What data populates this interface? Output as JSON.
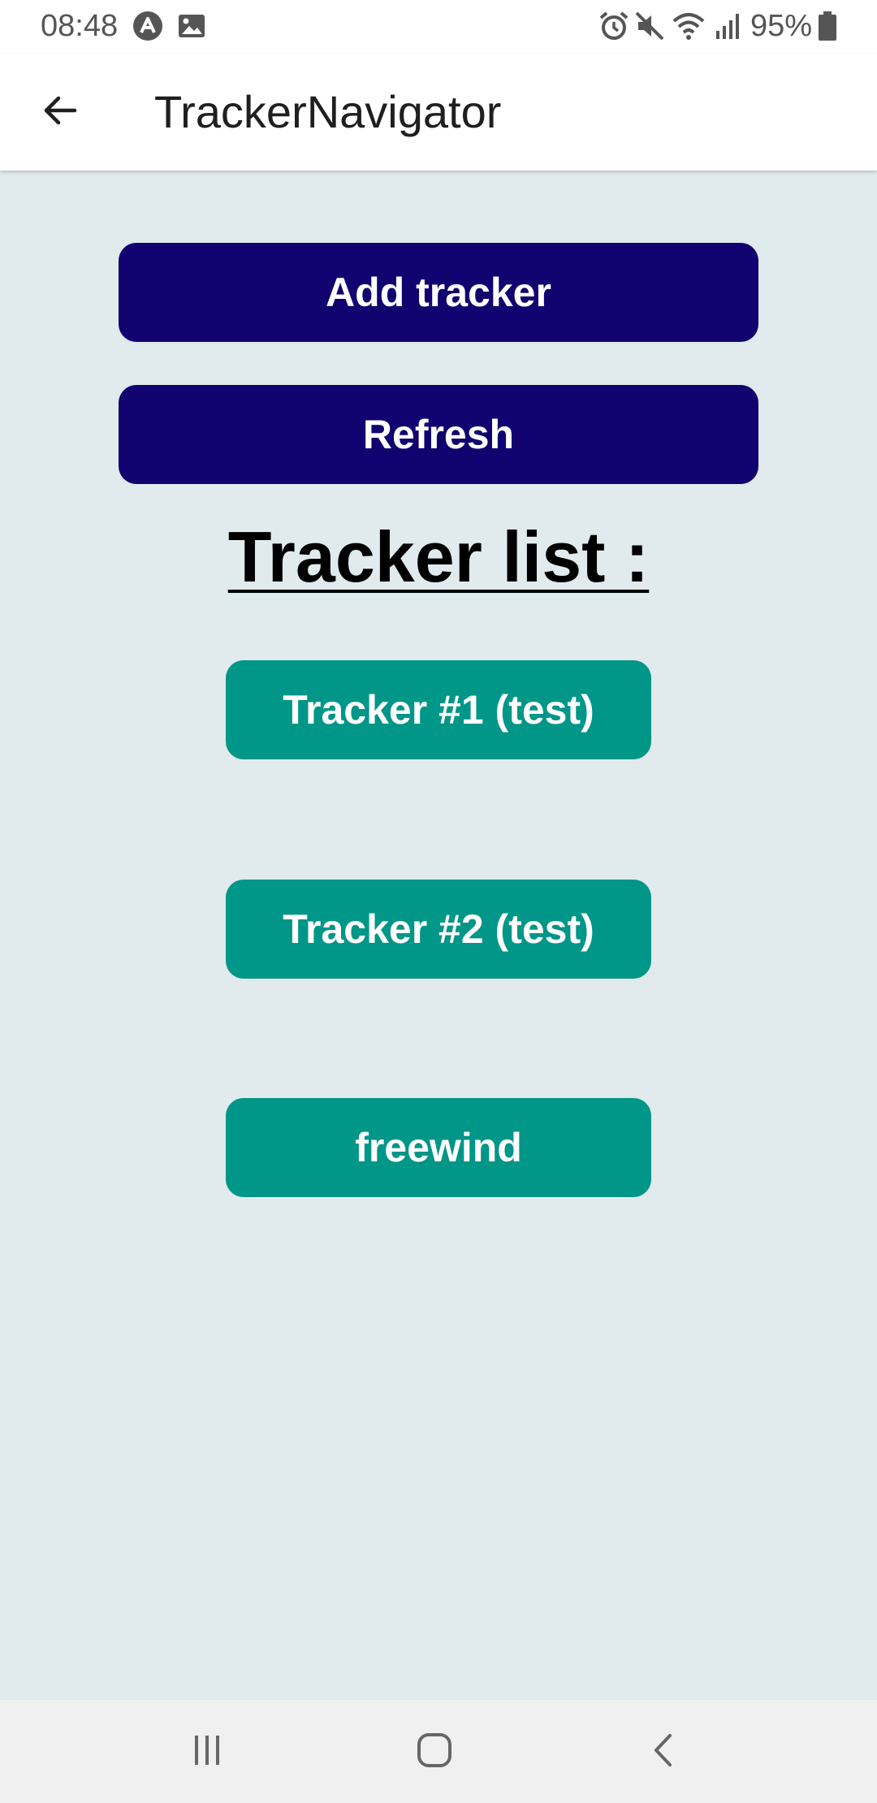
{
  "status_bar": {
    "time": "08:48",
    "battery": "95%",
    "icons": [
      "app-notification-icon",
      "image-notification-icon",
      "alarm-icon",
      "mute-icon",
      "wifi-icon",
      "signal-icon",
      "battery-icon"
    ]
  },
  "app_bar": {
    "title": "TrackerNavigator",
    "back_icon": "arrow-left-icon"
  },
  "actions": {
    "add_label": "Add tracker",
    "refresh_label": "Refresh"
  },
  "tracker_list": {
    "title": "Tracker list :",
    "items": [
      {
        "label": "Tracker #1 (test)"
      },
      {
        "label": "Tracker #2 (test)"
      },
      {
        "label": "freewind"
      }
    ]
  },
  "colors": {
    "primary_button": "#110270",
    "tracker_button": "#009688",
    "background": "#e1eaec"
  },
  "nav_bar": {
    "icons": [
      "recent-apps-icon",
      "home-icon",
      "back-icon"
    ]
  }
}
